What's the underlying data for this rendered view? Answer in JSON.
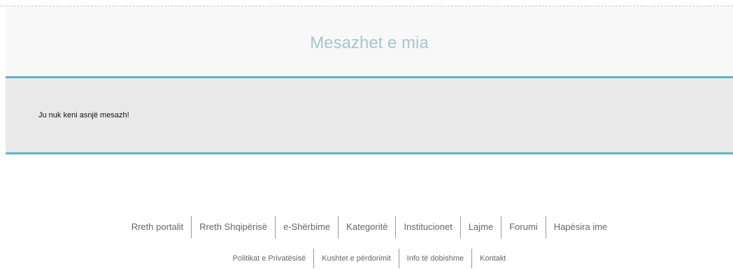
{
  "header": {
    "title": "Mesazhet e mia"
  },
  "messages": {
    "empty_text": "Ju nuk keni asnjë mesazh!"
  },
  "footer": {
    "primary_links": [
      "Rreth portalit",
      "Rreth Shqipërisë",
      "e-Shërbime",
      "Kategoritë",
      "Institucionet",
      "Lajme",
      "Forumi",
      "Hapësira ime"
    ],
    "secondary_links": [
      "Politikat e Privatësisë",
      "Kushtet e përdorimit",
      "Info të dobishme",
      "Kontakt"
    ]
  },
  "colors": {
    "accent": "#5bb8c4",
    "title": "#a7c6cd",
    "message_panel": "#e9e9e9",
    "link": "#666666"
  }
}
